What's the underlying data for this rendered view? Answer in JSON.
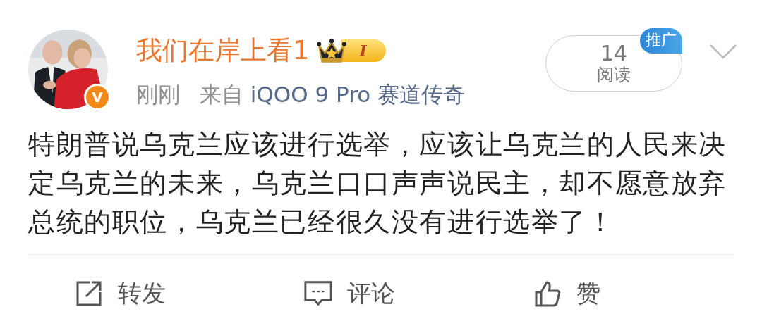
{
  "post": {
    "author": {
      "name": "我们在岸上看1",
      "level_badge": "I",
      "verified": true,
      "verified_mark": "V"
    },
    "meta": {
      "time": "刚刚",
      "source_prefix": "来自",
      "source": "iQOO 9 Pro 赛道传奇"
    },
    "reads": {
      "count": "14",
      "label": "阅读",
      "tag": "推广"
    },
    "text": "特朗普说乌克兰应该进行选举，应该让乌克兰的人民来决定乌克兰的未来，乌克兰口口声声说民主，却不愿意放弃总统的职位，乌克兰已经很久没有进行选举了！",
    "actions": [
      {
        "kind": "repost",
        "label": "转发"
      },
      {
        "kind": "comment",
        "label": "评论"
      },
      {
        "kind": "like",
        "label": "赞"
      }
    ]
  }
}
